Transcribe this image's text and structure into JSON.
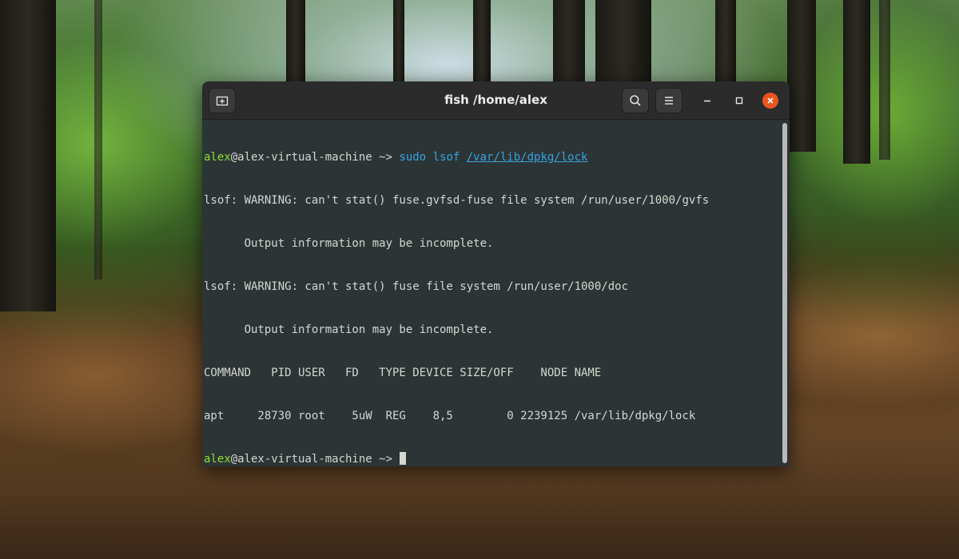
{
  "window": {
    "title": "fish /home/alex",
    "buttons": {
      "new_tab_icon": "new-tab-icon",
      "search_icon": "search-icon",
      "menu_icon": "hamburger-menu-icon",
      "minimize_icon": "minimize-icon",
      "maximize_icon": "maximize-icon",
      "close_icon": "close-icon"
    },
    "close_color": "#e95420"
  },
  "terminal": {
    "prompt_user": "alex",
    "prompt_host": "@alex-virtual-machine ~> ",
    "command_name": "sudo lsof",
    "command_arg": "/var/lib/dpkg/lock",
    "output": [
      "lsof: WARNING: can't stat() fuse.gvfsd-fuse file system /run/user/1000/gvfs",
      "      Output information may be incomplete.",
      "lsof: WARNING: can't stat() fuse file system /run/user/1000/doc",
      "      Output information may be incomplete.",
      "COMMAND   PID USER   FD   TYPE DEVICE SIZE/OFF    NODE NAME",
      "apt     28730 root    5uW  REG    8,5        0 2239125 /var/lib/dpkg/lock"
    ],
    "prompt2_user": "alex",
    "prompt2_host": "@alex-virtual-machine ~> ",
    "colors": {
      "background": "#2d3436",
      "foreground": "#d3d7cf",
      "user": "#8ae234",
      "command": "#34a4e0"
    }
  }
}
